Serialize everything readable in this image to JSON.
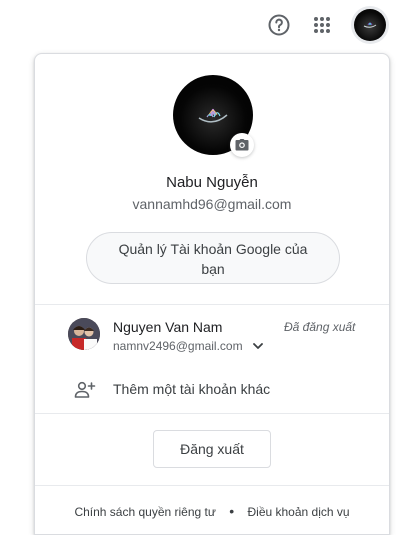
{
  "topbar": {
    "help_icon": "help-circle-icon",
    "apps_icon": "apps-grid-icon",
    "avatar_icon": "account-avatar"
  },
  "profile": {
    "name": "Nabu Nguyễn",
    "email": "vannamhd96@gmail.com",
    "camera_icon": "camera-icon",
    "manage_button": "Quản lý Tài khoản Google của bạn"
  },
  "accounts": [
    {
      "name": "Nguyen Van Nam",
      "email": "namnv2496@gmail.com",
      "status": "Đã đăng xuất"
    }
  ],
  "add_account": {
    "label": "Thêm một tài khoản khác",
    "icon": "person-add-icon"
  },
  "signout": {
    "label": "Đăng xuất"
  },
  "footer": {
    "privacy": "Chính sách quyền riêng tư",
    "separator": "•",
    "terms": "Điều khoản dịch vụ"
  },
  "colors": {
    "text_primary": "#202124",
    "text_secondary": "#5f6368",
    "border": "#dadce0",
    "icon": "#5f6368"
  }
}
